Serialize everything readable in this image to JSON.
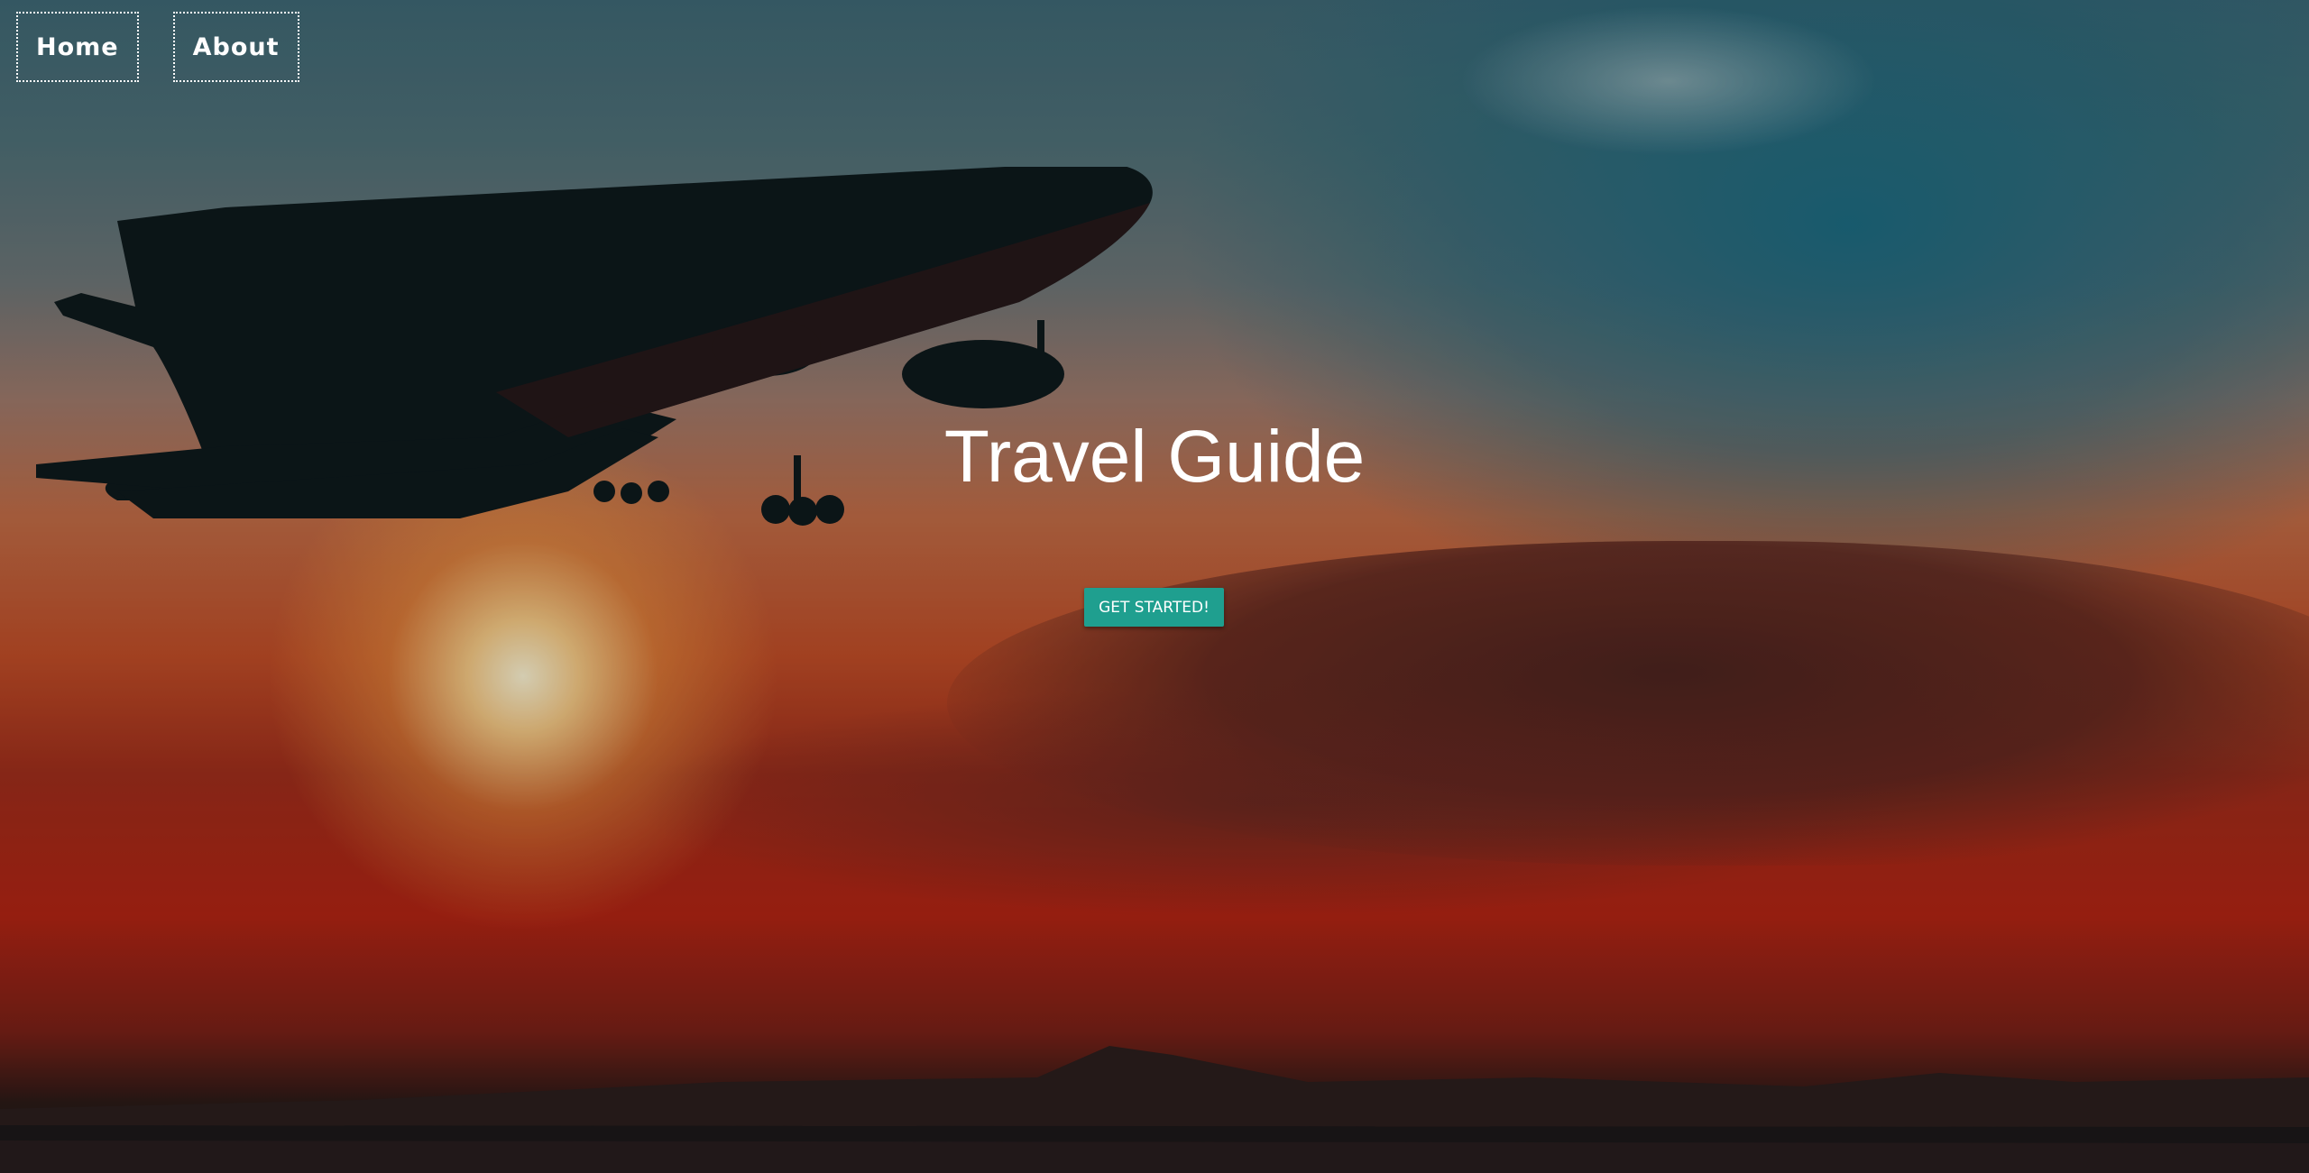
{
  "nav": {
    "items": [
      {
        "label": "Home"
      },
      {
        "label": "About"
      }
    ]
  },
  "hero": {
    "title": "Travel Guide",
    "cta_label": "GET STARTED!",
    "background_image": "airplane-silhouette-sunset-icon"
  },
  "colors": {
    "accent": "#1f9f8f",
    "text": "#ffffff",
    "nav_border": "#ffffff"
  }
}
